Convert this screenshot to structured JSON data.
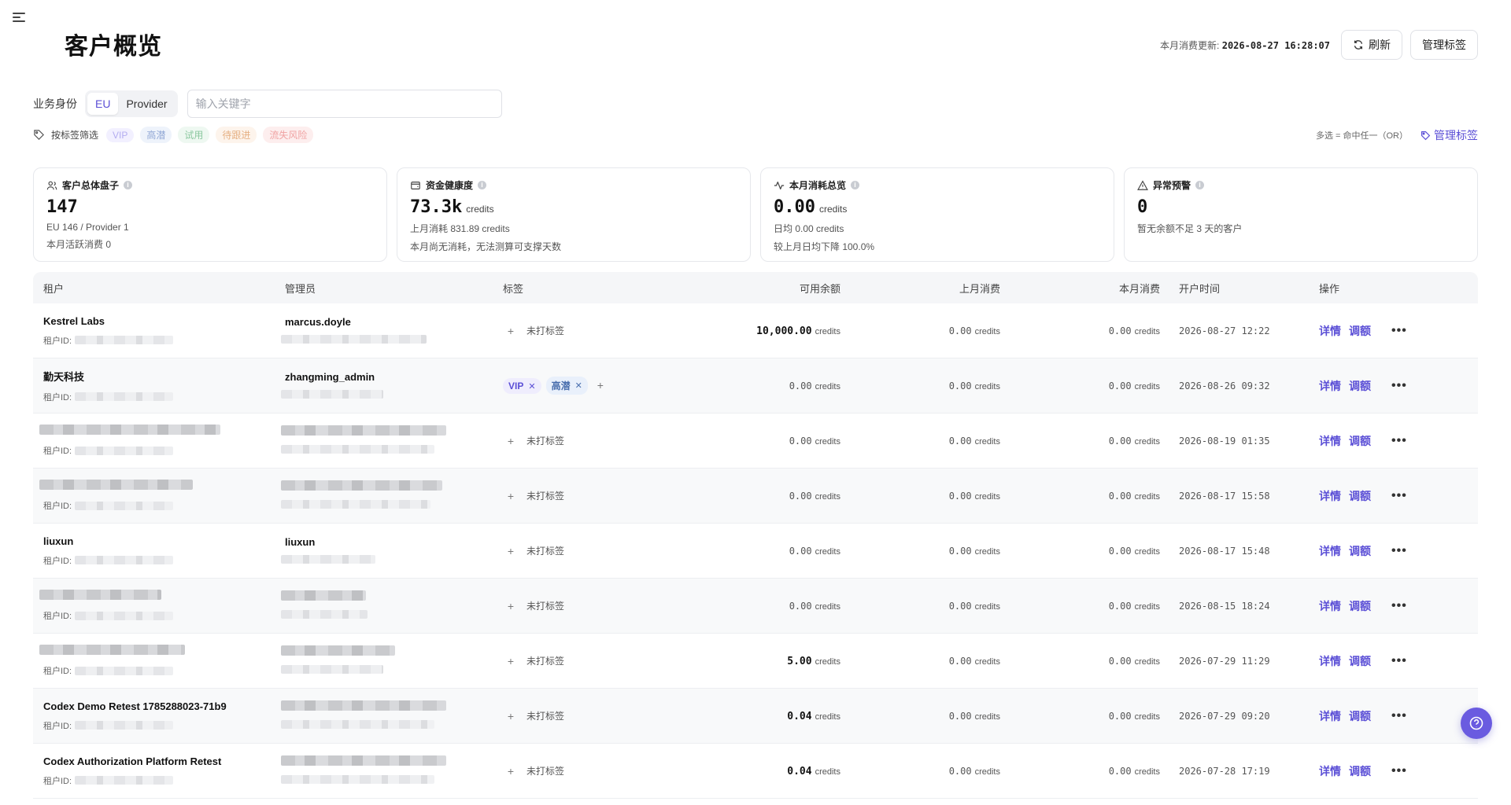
{
  "page": {
    "title": "客户概览"
  },
  "header": {
    "update_label": "本月消费更新:",
    "update_time": "2026-08-27 16:28:07",
    "refresh_label": "刷新",
    "manage_tags_label": "管理标签"
  },
  "filters": {
    "identity_label": "业务身份",
    "seg_eu": "EU",
    "seg_provider": "Provider",
    "search_placeholder": "输入关键字",
    "tag_filter_label": "按标签筛选",
    "chips": [
      "VIP",
      "高潜",
      "试用",
      "待跟进",
      "流失风险"
    ],
    "multi_hint": "多选 = 命中任一（OR）",
    "manage_tags_link": "管理标签"
  },
  "cards": [
    {
      "title": "客户总体盘子",
      "value": "147",
      "unit": "",
      "sub1": "EU 146 / Provider 1",
      "sub2": "本月活跃消费 0"
    },
    {
      "title": "资金健康度",
      "value": "73.3k",
      "unit": "credits",
      "sub1": "上月消耗 831.89 credits",
      "sub2": "本月尚无消耗，无法测算可支撑天数"
    },
    {
      "title": "本月消耗总览",
      "value": "0.00",
      "unit": "credits",
      "sub1": "日均 0.00 credits",
      "sub2": "较上月日均下降 100.0%"
    },
    {
      "title": "异常预警",
      "value": "0",
      "unit": "",
      "sub1": "暂无余额不足 3 天的客户",
      "sub2": ""
    }
  ],
  "table": {
    "headers": {
      "tenant": "租户",
      "admin": "管理员",
      "tags": "标签",
      "balance": "可用余额",
      "last_month": "上月消费",
      "this_month": "本月消费",
      "opened": "开户时间",
      "ops": "操作"
    },
    "id_label": "租户ID:",
    "unit": "credits",
    "no_tag": "未打标签",
    "detail": "详情",
    "adjust": "调额",
    "more": "•••",
    "rows": [
      {
        "name": "Kestrel Labs",
        "admin": "marcus.doyle",
        "tags": [],
        "balance": "10,000.00",
        "last": "0.00",
        "this": "0.00",
        "date": "2026-08-27 12:22"
      },
      {
        "name": "勤天科技",
        "admin": "zhangming_admin",
        "tags": [
          "VIP",
          "高潜"
        ],
        "balance": "0.00",
        "last": "0.00",
        "this": "0.00",
        "date": "2026-08-26 09:32"
      },
      {
        "name": "",
        "admin": "",
        "tags": [],
        "balance": "0.00",
        "last": "0.00",
        "this": "0.00",
        "date": "2026-08-19 01:35"
      },
      {
        "name": "",
        "admin": "",
        "tags": [],
        "balance": "0.00",
        "last": "0.00",
        "this": "0.00",
        "date": "2026-08-17 15:58"
      },
      {
        "name": "liuxun",
        "admin": "liuxun",
        "tags": [],
        "balance": "0.00",
        "last": "0.00",
        "this": "0.00",
        "date": "2026-08-17 15:48"
      },
      {
        "name": "",
        "admin": "",
        "tags": [],
        "balance": "0.00",
        "last": "0.00",
        "this": "0.00",
        "date": "2026-08-15 18:24"
      },
      {
        "name": "",
        "admin": "",
        "tags": [],
        "balance": "5.00",
        "last": "0.00",
        "this": "0.00",
        "date": "2026-07-29 11:29"
      },
      {
        "name": "Codex Demo Retest 1785288023-71b9",
        "admin": "",
        "tags": [],
        "balance": "0.04",
        "last": "0.00",
        "this": "0.00",
        "date": "2026-07-29 09:20"
      },
      {
        "name": "Codex Authorization Platform Retest",
        "admin": "",
        "tags": [],
        "balance": "0.04",
        "last": "0.00",
        "this": "0.00",
        "date": "2026-07-28 17:19"
      }
    ]
  },
  "icons": {
    "menu": "menu-icon",
    "refresh": "refresh-icon",
    "tag": "tag-icon",
    "users": "users-icon",
    "wallet": "wallet-icon",
    "activity": "activity-icon",
    "alert": "alert-icon",
    "help": "help-icon"
  },
  "colors": {
    "accent": "#5b4fd6"
  }
}
